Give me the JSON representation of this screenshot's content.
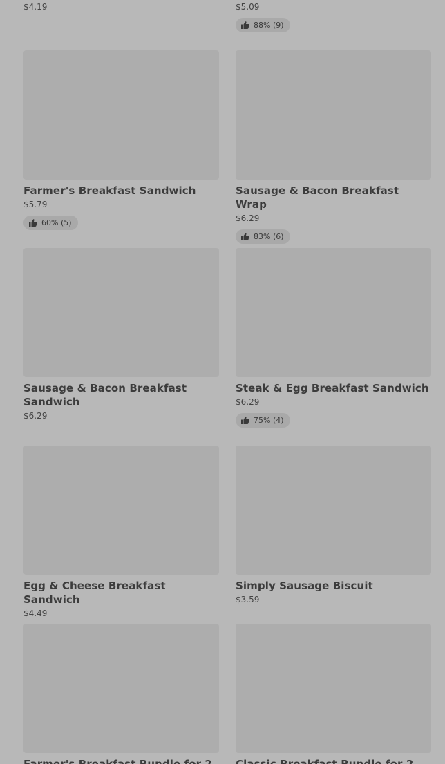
{
  "top_row": {
    "left_price": "$4.19",
    "right_price": "$5.09",
    "right_rating": "88% (9)"
  },
  "items": [
    {
      "name": "Farmer's Breakfast Sandwich",
      "price": "$5.79",
      "rating": "60% (5)"
    },
    {
      "name": "Sausage & Bacon Breakfast Wrap",
      "price": "$6.29",
      "rating": "83% (6)"
    },
    {
      "name": "Sausage & Bacon Breakfast Sandwich",
      "price": "$6.29",
      "rating": ""
    },
    {
      "name": "Steak & Egg Breakfast Sandwich",
      "price": "$6.29",
      "rating": "75% (4)"
    },
    {
      "name": "Egg & Cheese Breakfast Sandwich",
      "price": "$4.49",
      "rating": ""
    },
    {
      "name": "Simply Sausage Biscuit",
      "price": "$3.59",
      "rating": ""
    },
    {
      "name": "Farmer's Breakfast Bundle for 2",
      "price": "",
      "rating": ""
    },
    {
      "name": "Classic Breakfast Bundle for 2",
      "price": "",
      "rating": ""
    }
  ],
  "colors": {
    "background": "#b8b8b8",
    "thumbnail": "#adadad",
    "rating_pill": "#a9a9a9"
  },
  "icons": {
    "rating": "thumbs-up-icon"
  }
}
